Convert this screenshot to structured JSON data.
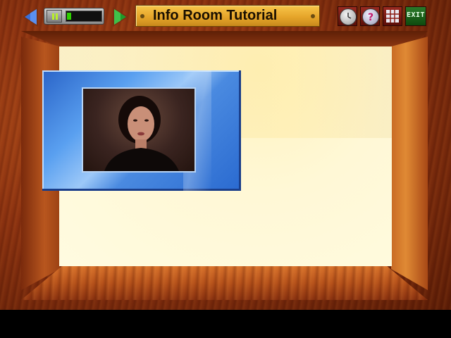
{
  "header": {
    "title": "Info Room Tutorial"
  },
  "toolbar": {
    "back_icon": "left-arrow-icon",
    "forward_icon": "right-arrow-icon",
    "pause_icon": "pause-icon",
    "playback_progress": 0.12,
    "history_icon": "clock-icon",
    "help_icon": "question-mark-icon",
    "grid_icon": "grid-icon",
    "exit_label": "EXIT"
  },
  "colors": {
    "arrow_blue": "#3a6fd8",
    "arrow_green": "#1f9a2a",
    "progress_green": "#2ed000",
    "title_gold": "#e6a52a",
    "video_frame_blue": "#4a8ae0"
  }
}
